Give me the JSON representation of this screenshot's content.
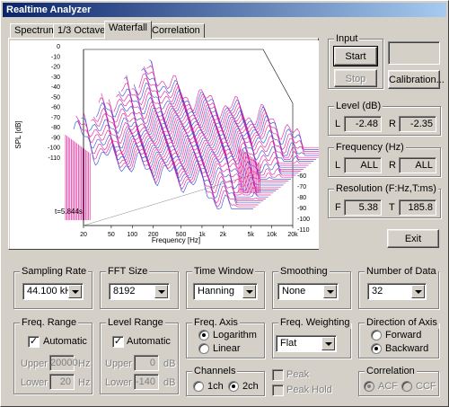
{
  "window": {
    "title": "Realtime Analyzer"
  },
  "tabs": [
    {
      "label": "Spectrum",
      "active": false
    },
    {
      "label": "1/3 Octave",
      "active": false
    },
    {
      "label": "Waterfall",
      "active": true
    },
    {
      "label": "Correlation",
      "active": false
    }
  ],
  "plot": {
    "y_axis_label": "SPL [dB]",
    "x_axis_label": "Frequency [Hz]",
    "time_label": "t=5.844s",
    "left_ticks": [
      "0",
      "-10",
      "-20",
      "-30",
      "-40",
      "-50",
      "-60",
      "-70",
      "-80",
      "-90",
      "-100",
      "-110"
    ],
    "right_ticks": [
      "-60",
      "-70",
      "-80",
      "-90",
      "-100",
      "-110"
    ],
    "x_ticks": [
      "20",
      "50",
      "100",
      "200",
      "500",
      "1k",
      "2k",
      "5k",
      "10k",
      "20k"
    ],
    "trace_color": "#e0209a",
    "trace_color_2": "#3050e0"
  },
  "input": {
    "title": "Input",
    "start_label": "Start",
    "stop_label": "Stop",
    "calibration_label": "Calibration..."
  },
  "level": {
    "title": "Level (dB)",
    "l_label": "L",
    "l_value": "-2.48",
    "r_label": "R",
    "r_value": "-2.35"
  },
  "frequency": {
    "title": "Frequency (Hz)",
    "l_label": "L",
    "l_value": "ALL",
    "r_label": "R",
    "r_value": "ALL"
  },
  "resolution": {
    "title": "Resolution (F:Hz,T:ms)",
    "f_label": "F",
    "f_value": "5.38",
    "t_label": "T",
    "t_value": "185.8"
  },
  "exit_label": "Exit",
  "sampling_rate": {
    "title": "Sampling Rate",
    "value": "44.100 kHz"
  },
  "fft_size": {
    "title": "FFT Size",
    "value": "8192"
  },
  "time_window": {
    "title": "Time Window",
    "value": "Hanning"
  },
  "smoothing": {
    "title": "Smoothing",
    "value": "None"
  },
  "number_of_data": {
    "title": "Number of Data",
    "value": "32"
  },
  "freq_range": {
    "title": "Freq. Range",
    "automatic_label": "Automatic",
    "upper_label": "Upper",
    "upper_value": "20000",
    "upper_unit": "Hz",
    "lower_label": "Lower",
    "lower_value": "20",
    "lower_unit": "Hz"
  },
  "level_range": {
    "title": "Level Range",
    "automatic_label": "Automatic",
    "upper_label": "Upper",
    "upper_value": "0",
    "upper_unit": "dB",
    "lower_label": "Lower",
    "lower_value": "-140",
    "lower_unit": "dB"
  },
  "freq_axis": {
    "title": "Freq. Axis",
    "option1": "Logarithm",
    "option2": "Linear"
  },
  "channels": {
    "title": "Channels",
    "option1": "1ch",
    "option2": "2ch"
  },
  "freq_weighting": {
    "title": "Freq. Weighting",
    "value": "Flat"
  },
  "peak": {
    "peak_label": "Peak",
    "peak_hold_label": "Peak Hold"
  },
  "direction": {
    "title": "Direction of Axis",
    "option1": "Forward",
    "option2": "Backward"
  },
  "correlation": {
    "title": "Correlation",
    "option1": "ACF",
    "option2": "CCF"
  }
}
